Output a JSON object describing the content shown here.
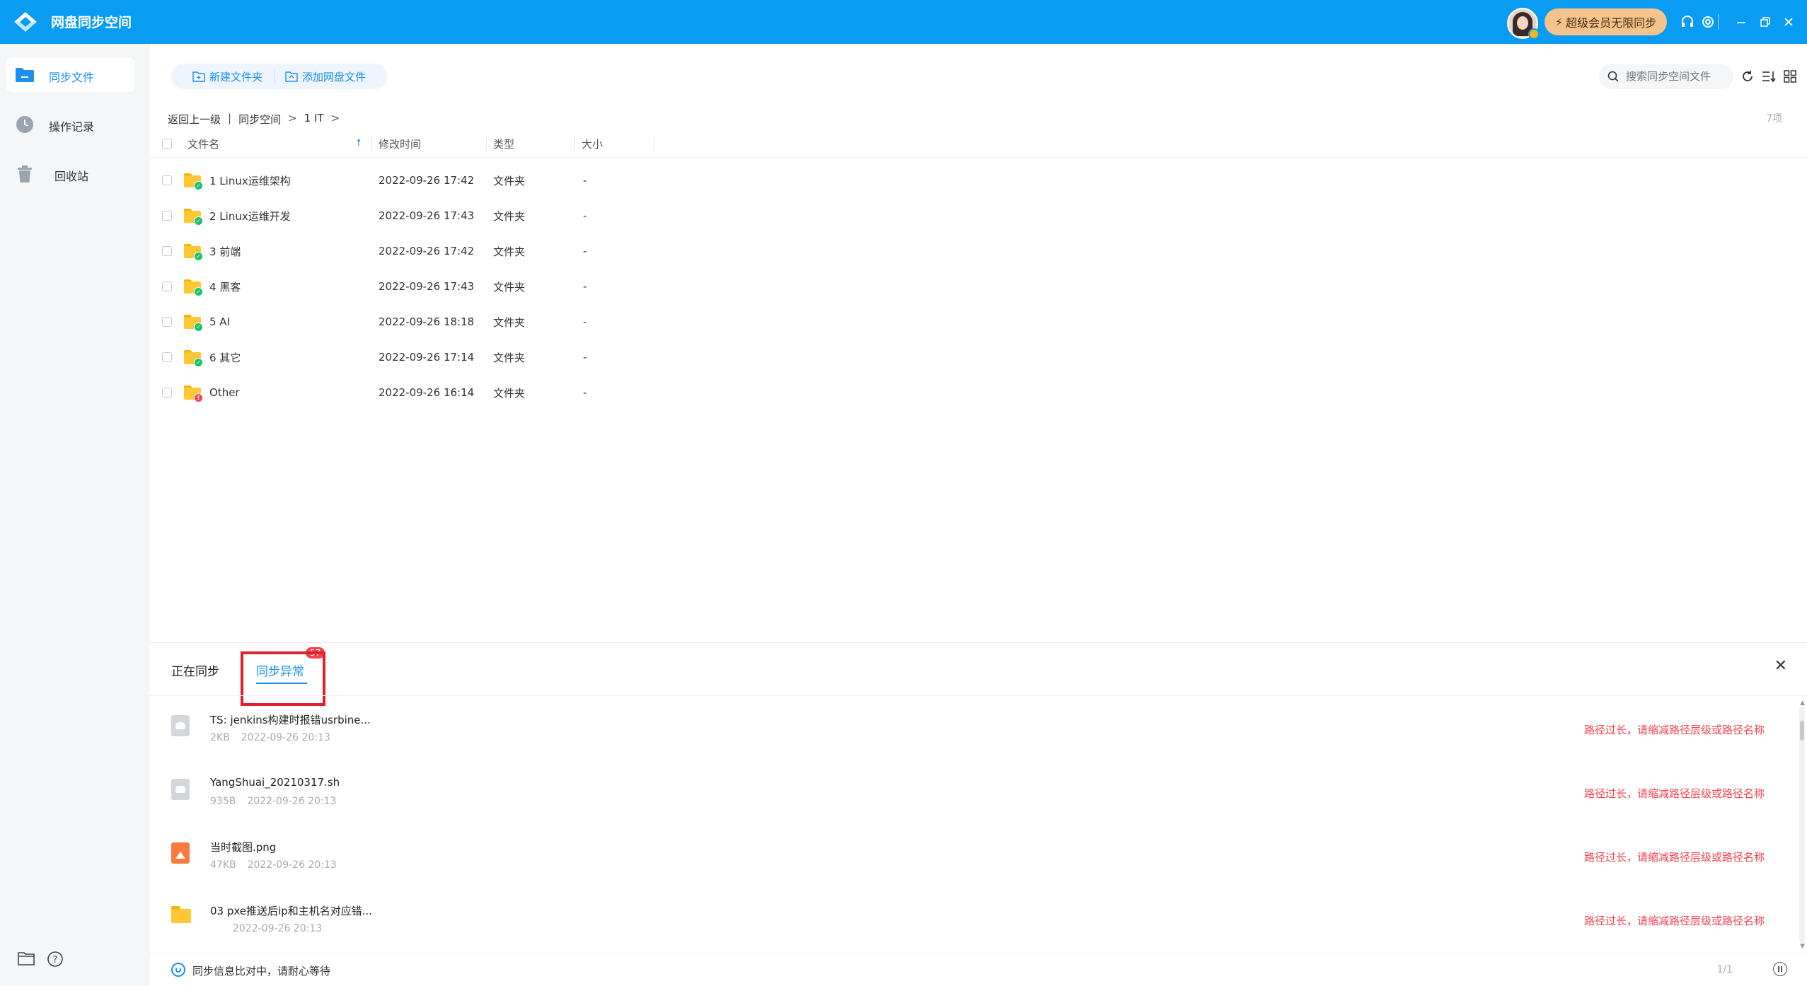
{
  "app": {
    "title": "网盘同步空间"
  },
  "titlebar": {
    "vip_label": "超级会员无限同步"
  },
  "sidebar": {
    "items": [
      {
        "label": "同步文件",
        "icon": "folder-icon",
        "active": true
      },
      {
        "label": "操作记录",
        "icon": "clock-icon",
        "active": false
      },
      {
        "label": "回收站",
        "icon": "trash-icon",
        "active": false
      }
    ]
  },
  "toolbar": {
    "new_folder": "新建文件夹",
    "add_netdisk_file": "添加网盘文件",
    "search_placeholder": "搜索同步空间文件"
  },
  "breadcrumb": {
    "back": "返回上一级",
    "divider": "|",
    "items": [
      "同步空间",
      "1 IT"
    ],
    "separator": ">"
  },
  "item_count": "7项",
  "table": {
    "headers": {
      "name": "文件名",
      "modified": "修改时间",
      "type": "类型",
      "size": "大小"
    },
    "rows": [
      {
        "name": "1 Linux运维架构",
        "modified": "2022-09-26 17:42",
        "type": "文件夹",
        "size": "-",
        "status": "ok"
      },
      {
        "name": "2 Linux运维开发",
        "modified": "2022-09-26 17:43",
        "type": "文件夹",
        "size": "-",
        "status": "ok"
      },
      {
        "name": "3 前端",
        "modified": "2022-09-26 17:42",
        "type": "文件夹",
        "size": "-",
        "status": "ok"
      },
      {
        "name": "4 黑客",
        "modified": "2022-09-26 17:43",
        "type": "文件夹",
        "size": "-",
        "status": "ok"
      },
      {
        "name": "5 AI",
        "modified": "2022-09-26 18:18",
        "type": "文件夹",
        "size": "-",
        "status": "ok"
      },
      {
        "name": "6 其它",
        "modified": "2022-09-26 17:14",
        "type": "文件夹",
        "size": "-",
        "status": "ok"
      },
      {
        "name": "Other",
        "modified": "2022-09-26 16:14",
        "type": "文件夹",
        "size": "-",
        "status": "error"
      }
    ]
  },
  "panel": {
    "tab_syncing": "正在同步",
    "tab_errors": "同步异常",
    "error_count": "57",
    "errors": [
      {
        "name": "TS: jenkins构建时报错usrbine...",
        "size": "2KB",
        "time": "2022-09-26 20:13",
        "message": "路径过长，请缩减路径层级或路径名称",
        "icon": "file-icon"
      },
      {
        "name": "YangShuai_20210317.sh",
        "size": "935B",
        "time": "2022-09-26 20:13",
        "message": "路径过长，请缩减路径层级或路径名称",
        "icon": "file-icon"
      },
      {
        "name": "当时截图.png",
        "size": "47KB",
        "time": "2022-09-26 20:13",
        "message": "路径过长，请缩减路径层级或路径名称",
        "icon": "image-icon"
      },
      {
        "name": "03 pxe推送后ip和主机名对应错...",
        "size": "",
        "time": "2022-09-26 20:13",
        "message": "路径过长，请缩减路径层级或路径名称",
        "icon": "folder-icon"
      }
    ]
  },
  "status": {
    "text": "同步信息比对中，请耐心等待",
    "pager": "1/1"
  },
  "colors": {
    "primary": "#0a9cf3",
    "accent": "#1b8ff0",
    "error": "#f4424f",
    "folder": "#ffc833"
  }
}
